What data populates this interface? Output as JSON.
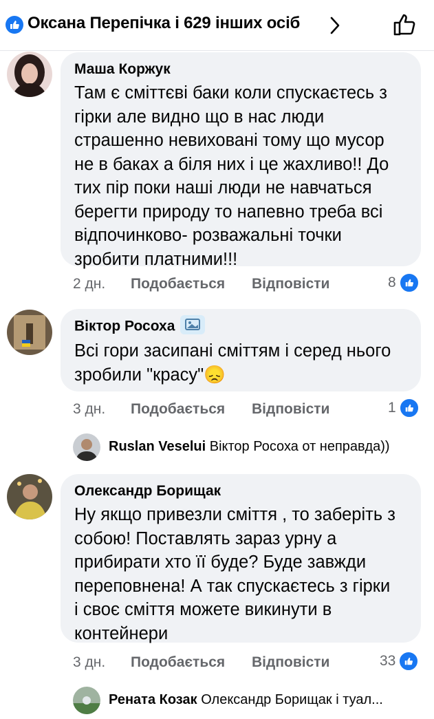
{
  "header": {
    "title": "Оксана Перепічка і 629 інших осіб"
  },
  "comments": [
    {
      "author": "Маша Коржук",
      "lines": [
        "Там є сміттєві баки коли спускаєтесь з",
        "гірки але видно що в нас люди",
        "страшенно невиховані тому що мусор",
        "не в баках а біля них і це жахливо!! До",
        "тих пір поки наші люди не навчаться",
        "берегти природу то напевно треба всі",
        "відпочинково- розважальні точки",
        "зробити платними!!!"
      ],
      "time": "2 дн.",
      "like_label": "Подобається",
      "reply_label": "Відповісти",
      "likes": "8"
    },
    {
      "author": "Віктор Росоха",
      "lines": [
        "Всі гори засипані сміттям і серед нього",
        "зробили \"красу\"😞"
      ],
      "time": "3 дн.",
      "like_label": "Подобається",
      "reply_label": "Відповісти",
      "likes": "1",
      "reply": {
        "name": "Ruslan Veselui",
        "text": "Віктор Росоха от неправда))"
      }
    },
    {
      "author": "Олександр Борищак",
      "lines": [
        "Ну якщо привезли сміття , то заберіть з",
        "собою! Поставлять зараз урну а",
        "прибирати хто її буде? Буде завжди",
        "переповнена! А так спускаєтесь з гірки",
        "і своє сміття можете викинути в",
        "контейнери"
      ],
      "time": "3 дн.",
      "like_label": "Подобається",
      "reply_label": "Відповісти",
      "likes": "33",
      "reply": {
        "name": "Рената Козак",
        "text": "Олександр Борищак  і туал..."
      }
    }
  ],
  "colors": {
    "accent": "#1877f2",
    "bubble": "#f0f2f5",
    "meta": "#65676b"
  }
}
